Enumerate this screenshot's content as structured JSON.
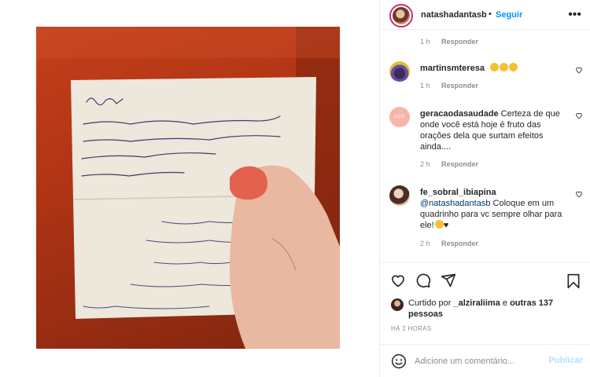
{
  "post": {
    "username": "natashadantasb",
    "separator": "•",
    "follow_label": "Seguir",
    "more_icon": "more-horizontal-icon",
    "note_lines": [
      "Daniel 6 -",
      "1º O seu nome será chamado por Deus",
      "2º Os teus inimigos vão morrerão",
      "antes de ver tua vitória",
      "3º Você vai prosperar"
    ]
  },
  "comments": [
    {
      "username": "",
      "text": "",
      "time": "1 h",
      "reply_label": "Responder"
    },
    {
      "username": "martinsmteresa",
      "text": "",
      "emoji_count": 3,
      "time": "1 h",
      "reply_label": "Responder"
    },
    {
      "username": "geracaodasaudade",
      "text": "Certeza de que onde você está hoje é fruto das orações dela que surtam efeitos ainda....",
      "time": "2 h",
      "reply_label": "Responder",
      "avatar_text": "GDS"
    },
    {
      "username": "fe_sobral_ibiapina",
      "mention": "@natashadantasb",
      "text": "Coloque em um quadrinho para vc sempre olhar para ele!",
      "time": "2 h",
      "reply_label": "Responder"
    }
  ],
  "likes": {
    "prefix": "Curtido por",
    "user": "_alziraliima",
    "connector": "e",
    "others": "outras 137 pessoas"
  },
  "time_ago": "HÁ 2 HORAS",
  "add_comment": {
    "placeholder": "Adicione um comentário...",
    "post_label": "Publicar"
  },
  "colors": {
    "accent": "#0095f6",
    "post_disabled": "#b2dffc",
    "text": "#262626",
    "muted": "#8e8e8e",
    "background_orange": "#c4401c"
  }
}
